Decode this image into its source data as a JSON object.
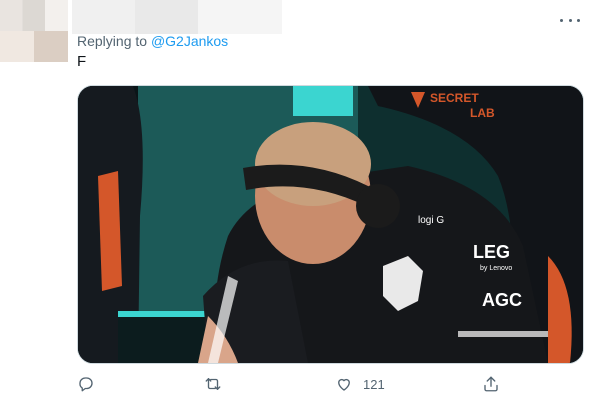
{
  "reply": {
    "prefix": "Replying to ",
    "handle": "@G2Jankos"
  },
  "tweet": {
    "text": "F"
  },
  "media": {
    "brand_text_1": "SECRET",
    "brand_text_2": "LAB",
    "jersey_text_1": "LEG",
    "jersey_text_2": "by Lenovo",
    "jersey_text_3": "AGC",
    "headset_text": "logi G"
  },
  "actions": {
    "reply_icon": "reply-icon",
    "retweet_icon": "retweet-icon",
    "like_icon": "heart-icon",
    "like_count": "121",
    "share_icon": "share-icon"
  },
  "colors": {
    "accent": "#1d9bf0",
    "muted": "#536471",
    "text": "#0f1419"
  }
}
